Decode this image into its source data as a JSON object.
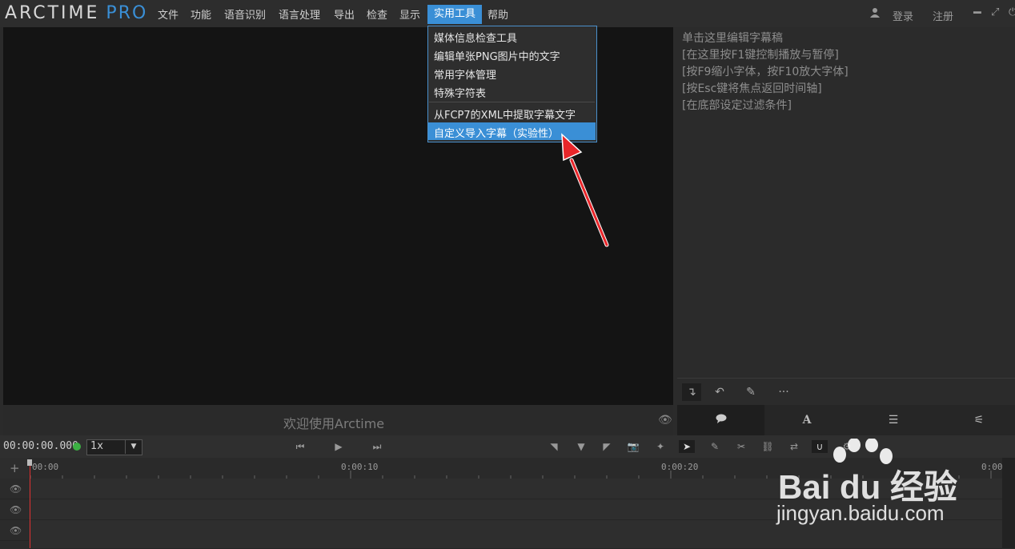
{
  "app": {
    "logo_main": "ARCTIME",
    "logo_pro": "PRO"
  },
  "menubar": {
    "items": [
      "文件",
      "功能",
      "语音识别",
      "语言处理",
      "导出",
      "检查",
      "显示",
      "实用工具",
      "帮助"
    ],
    "login": "登录",
    "register": "注册"
  },
  "dropdown": {
    "items": [
      "媒体信息检查工具",
      "编辑单张PNG图片中的文字",
      "常用字体管理",
      "特殊字符表",
      "从FCP7的XML中提取字幕文字",
      "自定义导入字幕（实验性）"
    ],
    "highlighted_index": 5
  },
  "editor": {
    "hints": [
      "单击这里编辑字幕稿",
      "[在这里按F1键控制播放与暂停]",
      "[按F9缩小字体，按F10放大字体]",
      "[按Esc键将焦点返回时间轴]",
      "[在底部设定过滤条件]"
    ]
  },
  "video": {
    "welcome": "欢迎使用Arctime"
  },
  "transport": {
    "timecode": "00:00:00.000",
    "speed": "1x"
  },
  "timeline": {
    "ticks": [
      "00:00",
      "0:00:10",
      "0:00:20",
      "0:00:"
    ]
  },
  "watermark": {
    "brand": "Bai du 经验",
    "url": "jingyan.baidu.com"
  },
  "colors": {
    "accent": "#3a8fd6",
    "playhead": "#e03030",
    "status_dot": "#3cb043",
    "annotation_arrow": "#e8262a"
  }
}
